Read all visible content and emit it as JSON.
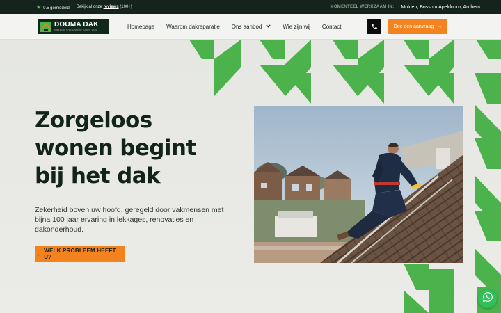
{
  "topbar": {
    "rating": "9.5 gemiddeld",
    "reviews_prefix": "Bekijk al onze",
    "reviews_link": "reviews",
    "reviews_count": "(100+)",
    "working_label": "MOMENTEEL WERKZAAM IN:",
    "working_value": "Mulden, Bussum Apeldoorn, Arnhem"
  },
  "logo": {
    "name": "DOUMA DAK",
    "tagline": "KWALITATIEVE DAKEN · SINDS 1926"
  },
  "nav": {
    "items": [
      {
        "label": "Homepage"
      },
      {
        "label": "Waarom dakreparatie"
      },
      {
        "label": "Ons aanbod"
      },
      {
        "label": "Wie zijn wij"
      },
      {
        "label": "Contact"
      }
    ],
    "cta_label": "Doe een aanvraag",
    "phone_icon": "phone-icon",
    "chevron_icon": "chevron-down-icon"
  },
  "hero": {
    "headline": [
      "Zorgeloos",
      "wonen begint",
      "bij het dak"
    ],
    "intro": "Zekerheid boven uw hoofd, geregeld door vakmensen met bijna 100 jaar ervaring in lekkages, renovaties en dakonderhoud.",
    "button_label": "WELK PROBLEEM HEEFT U?"
  },
  "colors": {
    "dark_green": "#14231b",
    "accent_green": "#4cb34c",
    "orange": "#f4821f",
    "whatsapp": "#2fc05a"
  }
}
